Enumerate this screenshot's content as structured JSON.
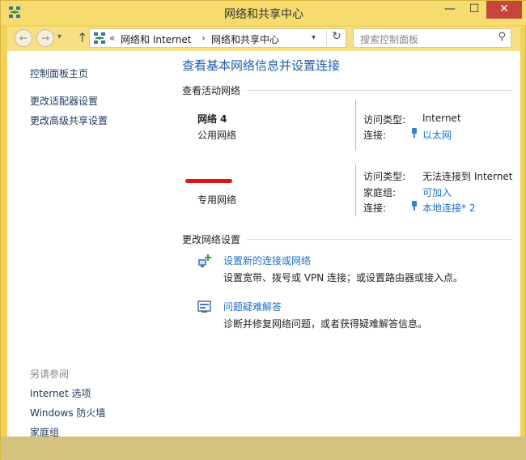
{
  "window": {
    "title": "网络和共享中心",
    "close_glyph": "✕",
    "min_glyph": "—",
    "max_glyph": "☐"
  },
  "nav": {
    "back": "←",
    "forward": "→",
    "up": "↑",
    "address_sep": "«",
    "crumb1": "网络和 Internet",
    "crumb_arrow": "›",
    "crumb2": "网络和共享中心",
    "refresh": "↻",
    "search_placeholder": "搜索控制面板",
    "search_icon": "⚲"
  },
  "sidebar": {
    "items": [
      "控制面板主页",
      "更改适配器设置",
      "更改高级共享设置"
    ],
    "see_also_caption": "另请参阅",
    "see_also": [
      "Internet 选项",
      "Windows 防火墙",
      "家庭组"
    ]
  },
  "main": {
    "title": "查看基本网络信息并设置连接",
    "active_networks_heading": "查看活动网络",
    "network1": {
      "name": "网络  4",
      "category": "公用网络",
      "access_label": "访问类型:",
      "access_value": "Internet",
      "conn_label": "连接:",
      "conn_value": "以太网"
    },
    "network2": {
      "category": "专用网络",
      "access_label": "访问类型:",
      "access_value": "无法连接到 Internet",
      "homegroup_label": "家庭组:",
      "homegroup_value": "可加入",
      "conn_label": "连接:",
      "conn_value": "本地连接* 2"
    },
    "change_settings_heading": "更改网络设置",
    "task1": {
      "title": "设置新的连接或网络",
      "desc": "设置宽带、拨号或 VPN 连接；或设置路由器或接入点。"
    },
    "task2": {
      "title": "问题疑难解答",
      "desc": "诊断并修复网络问题，或者获得疑难解答信息。"
    }
  },
  "colors": {
    "accent": "#1e6fcc",
    "title_blue": "#1e5faa",
    "frame": "#f2d25a",
    "close": "#c7463b"
  }
}
